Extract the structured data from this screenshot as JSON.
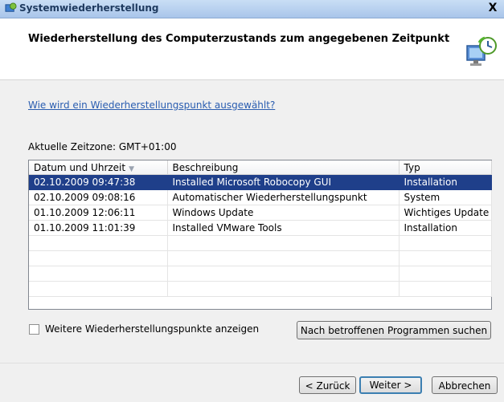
{
  "window": {
    "title": "Systemwiederherstellung",
    "close_label": "X"
  },
  "header": {
    "heading": "Wiederherstellung des Computerzustands zum angegebenen Zeitpunkt"
  },
  "content": {
    "help_link": "Wie wird ein Wiederherstellungspunkt ausgewählt?",
    "timezone": "Aktuelle Zeitzone: GMT+01:00"
  },
  "table": {
    "columns": [
      "Datum und Uhrzeit",
      "Beschreibung",
      "Typ"
    ],
    "rows": [
      [
        "02.10.2009 09:47:38",
        "Installed Microsoft Robocopy GUI",
        "Installation"
      ],
      [
        "02.10.2009 09:08:16",
        "Automatischer Wiederherstellungspunkt",
        "System"
      ],
      [
        "01.10.2009 12:06:11",
        "Windows Update",
        "Wichtiges Update"
      ],
      [
        "01.10.2009 11:01:39",
        "Installed VMware Tools",
        "Installation"
      ]
    ],
    "selected_row": 0
  },
  "options": {
    "show_more_label": "Weitere Wiederherstellungspunkte anzeigen",
    "scan_button": "Nach betroffenen Programmen suchen"
  },
  "footer": {
    "back": "< Zurück",
    "next": "Weiter >",
    "cancel": "Abbrechen"
  },
  "colors": {
    "selection": "#1f3f8a",
    "link": "#2a5db0",
    "titlebar": "#b6cfee"
  }
}
